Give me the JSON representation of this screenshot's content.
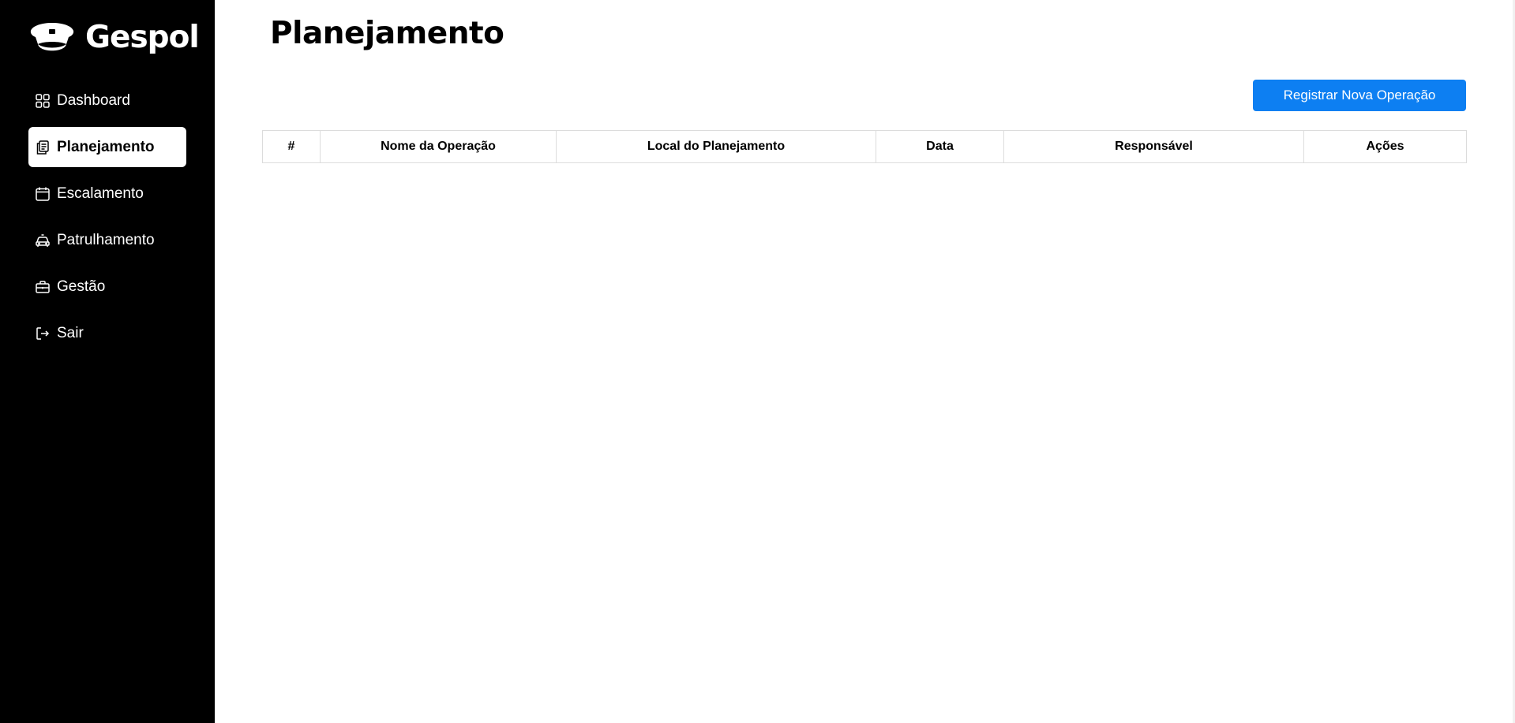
{
  "brand": {
    "name": "Gespol",
    "logo_icon": "police-cap-icon"
  },
  "sidebar": {
    "items": [
      {
        "label": "Dashboard",
        "icon": "grid-icon",
        "active": false
      },
      {
        "label": "Planejamento",
        "icon": "clipboard-icon",
        "active": true
      },
      {
        "label": "Escalamento",
        "icon": "calendar-icon",
        "active": false
      },
      {
        "label": "Patrulhamento",
        "icon": "police-car-icon",
        "active": false
      },
      {
        "label": "Gestão",
        "icon": "briefcase-icon",
        "active": false
      },
      {
        "label": "Sair",
        "icon": "logout-icon",
        "active": false
      }
    ]
  },
  "main": {
    "title": "Planejamento",
    "new_button_label": "Registrar Nova Operação"
  },
  "table": {
    "columns": [
      "#",
      "Nome da Operação",
      "Local do Planejamento",
      "Data",
      "Responsável",
      "Ações"
    ],
    "rows": []
  },
  "colors": {
    "sidebar_bg": "#000000",
    "primary": "#0d7ff2",
    "active_item_bg": "#ffffff"
  }
}
